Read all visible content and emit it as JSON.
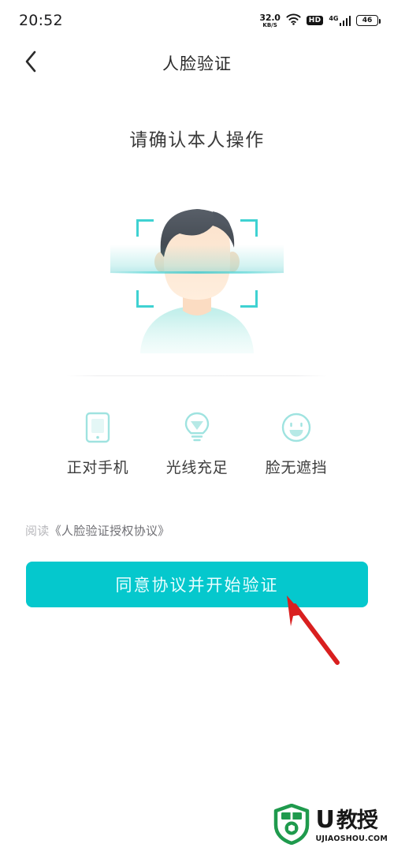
{
  "status_bar": {
    "clock": "20:52",
    "net_speed_value": "32.0",
    "net_speed_unit": "KB/S",
    "wifi_icon": "wifi-icon",
    "hd_badge": "HD",
    "network_type": "4G",
    "signal_icon": "signal-bars-icon",
    "battery_level": "46"
  },
  "nav": {
    "back_icon": "chevron-left-icon",
    "title": "人脸验证"
  },
  "main": {
    "heading": "请确认本人操作",
    "face_illustration": "face-scan-illustration",
    "tips": [
      {
        "icon": "phone-icon",
        "label": "正对手机"
      },
      {
        "icon": "lightbulb-icon",
        "label": "光线充足"
      },
      {
        "icon": "smiley-face-icon",
        "label": "脸无遮挡"
      }
    ],
    "agreement": {
      "prefix": "阅读",
      "link": "《人脸验证授权协议》"
    },
    "cta_label": "同意协议并开始验证"
  },
  "annotation": {
    "arrow_icon": "red-arrow-pointer",
    "color": "#d91f1f"
  },
  "watermark": {
    "shield_icon": "shield-logo-icon",
    "letter": "U",
    "name": "教授",
    "domain": "UJIAOSHOU.COM"
  },
  "colors": {
    "accent": "#05c8cd",
    "frame": "#3fd2d2",
    "tip_icon": "#9fe3e0",
    "text_primary": "#3a3a3a",
    "text_muted": "#b8b8bc",
    "annotation_red": "#d91f1f",
    "watermark_green": "#1f9a4d"
  }
}
